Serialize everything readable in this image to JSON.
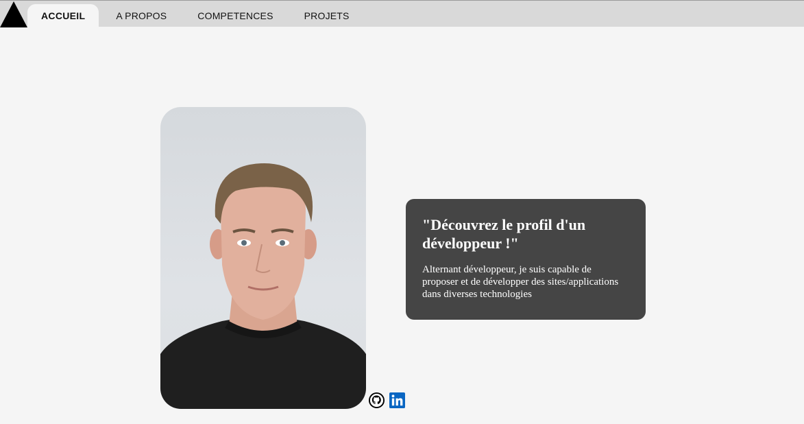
{
  "header": {
    "logo": "triangle-logo",
    "nav": [
      {
        "label": "ACCUEIL",
        "active": true
      },
      {
        "label": "A PROPOS",
        "active": false
      },
      {
        "label": "COMPETENCES",
        "active": false
      },
      {
        "label": "PROJETS",
        "active": false
      }
    ]
  },
  "hero": {
    "photo": "profile-photo",
    "card": {
      "title": "\"Découvrez le profil d'un développeur !\"",
      "text": "Alternant développeur, je suis capable de proposer et de développer des sites/applications dans diverses technologies"
    },
    "social": [
      {
        "icon": "github-icon"
      },
      {
        "icon": "linkedin-icon"
      }
    ]
  },
  "colors": {
    "background": "#f5f5f5",
    "topbar": "#d9d9d9",
    "card": "#454545",
    "linkedin": "#0a66c2"
  }
}
